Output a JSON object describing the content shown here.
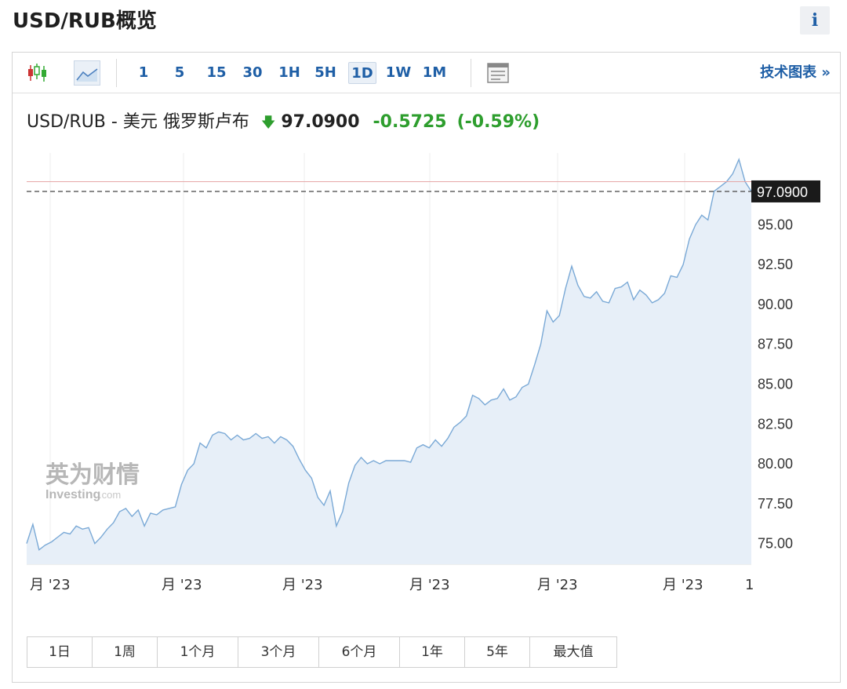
{
  "header": {
    "title": "USD/RUB概览",
    "info_label": "i"
  },
  "toolbar": {
    "timeframes": [
      "1",
      "5",
      "15",
      "30",
      "1H",
      "5H",
      "1D",
      "1W",
      "1M"
    ],
    "active_timeframe": "1D",
    "tech_chart_label": "技术图表 »"
  },
  "quote": {
    "name": "USD/RUB - 美元 俄罗斯卢布",
    "arrow": "🡇",
    "price": "97.0900",
    "change": "-0.5725",
    "change_pct": "(-0.59%)"
  },
  "watermark": {
    "cn": "英为财情",
    "en": "Investing",
    "suffix": ".com"
  },
  "ranges": [
    "1日",
    "1周",
    "1个月",
    "3个月",
    "6个月",
    "1年",
    "5年",
    "最大值"
  ],
  "chart_data": {
    "type": "area",
    "y_tick_labels": [
      "75.00",
      "77.50",
      "80.00",
      "82.50",
      "85.00",
      "87.50",
      "90.00",
      "92.50",
      "95.00"
    ],
    "x_tick_labels": [
      "月 '23",
      "月 '23",
      "月 '23",
      "月 '23",
      "月 '23",
      "月 '23",
      "1"
    ],
    "ylim": [
      73.7,
      99.5
    ],
    "current_price": 97.09,
    "current_price_label": "97.0900",
    "reference_line": 97.7,
    "grid": true,
    "colors": {
      "line": "#7aa9d6",
      "fill": "#e7eff8",
      "ref_line": "#e6a8a8",
      "dash": "#555555"
    },
    "values": [
      75.0,
      76.2,
      74.6,
      74.9,
      75.1,
      75.4,
      75.7,
      75.6,
      76.1,
      75.9,
      76.0,
      75.0,
      75.4,
      75.9,
      76.3,
      77.0,
      77.2,
      76.7,
      77.1,
      76.1,
      76.9,
      76.8,
      77.1,
      77.2,
      77.3,
      78.7,
      79.6,
      80.0,
      81.3,
      81.0,
      81.8,
      82.0,
      81.9,
      81.5,
      81.8,
      81.5,
      81.6,
      81.9,
      81.6,
      81.7,
      81.3,
      81.7,
      81.5,
      81.1,
      80.3,
      79.6,
      79.1,
      77.9,
      77.4,
      78.3,
      76.1,
      77.0,
      78.8,
      79.9,
      80.4,
      80.0,
      80.2,
      80.0,
      80.2,
      80.2,
      80.2,
      80.2,
      80.1,
      81.0,
      81.2,
      81.0,
      81.5,
      81.1,
      81.6,
      82.3,
      82.6,
      83.0,
      84.3,
      84.1,
      83.7,
      84.0,
      84.1,
      84.7,
      84.0,
      84.2,
      84.8,
      85.0,
      86.2,
      87.5,
      89.6,
      88.9,
      89.3,
      91.0,
      92.4,
      91.2,
      90.5,
      90.4,
      90.8,
      90.2,
      90.1,
      91.0,
      91.1,
      91.4,
      90.3,
      90.9,
      90.6,
      90.1,
      90.3,
      90.7,
      91.8,
      91.7,
      92.5,
      94.1,
      95.0,
      95.6,
      95.3,
      97.1,
      97.4,
      97.7,
      98.2,
      99.1,
      97.7,
      97.09
    ]
  }
}
